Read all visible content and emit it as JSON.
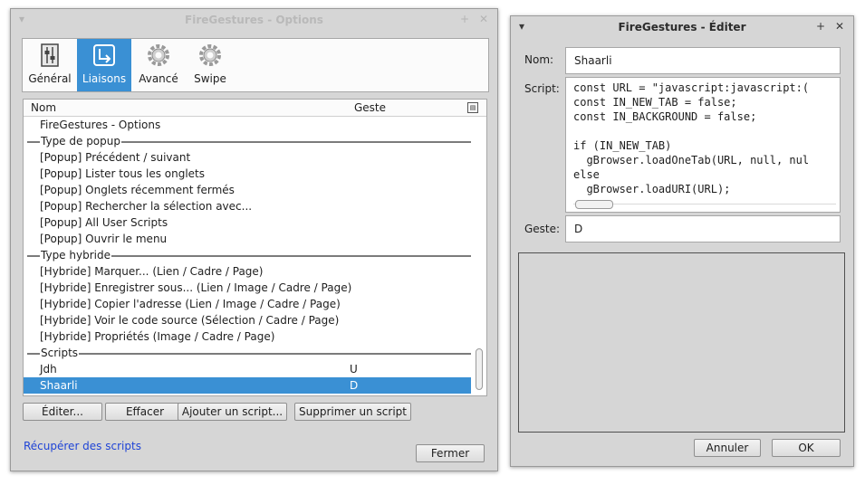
{
  "options": {
    "title": "FireGestures - Options",
    "menu_glyph": "▾",
    "min_glyph": "+",
    "close_glyph": "✕",
    "tabs": [
      {
        "label": "Général",
        "icon": "general-settings-icon"
      },
      {
        "label": "Liaisons",
        "icon": "bindings-icon"
      },
      {
        "label": "Avancé",
        "icon": "gear-icon"
      },
      {
        "label": "Swipe",
        "icon": "gear-icon"
      }
    ],
    "columns": {
      "name": "Nom",
      "gesture": "Geste"
    },
    "rows": [
      {
        "name": "FireGestures - Options",
        "gesture": ""
      },
      {
        "name": "Type de popup",
        "gesture": "",
        "group": true
      },
      {
        "name": "[Popup] Précédent / suivant",
        "gesture": ""
      },
      {
        "name": "[Popup] Lister tous les onglets",
        "gesture": ""
      },
      {
        "name": "[Popup] Onglets récemment fermés",
        "gesture": ""
      },
      {
        "name": "[Popup] Rechercher la sélection avec...",
        "gesture": ""
      },
      {
        "name": "[Popup] All User Scripts",
        "gesture": ""
      },
      {
        "name": "[Popup] Ouvrir le menu",
        "gesture": ""
      },
      {
        "name": "Type hybride",
        "gesture": "",
        "group": true
      },
      {
        "name": "[Hybride] Marquer... (Lien / Cadre / Page)",
        "gesture": ""
      },
      {
        "name": "[Hybride] Enregistrer sous... (Lien / Image / Cadre / Page)",
        "gesture": ""
      },
      {
        "name": "[Hybride] Copier l'adresse (Lien / Image / Cadre / Page)",
        "gesture": ""
      },
      {
        "name": "[Hybride] Voir le code source (Sélection / Cadre / Page)",
        "gesture": ""
      },
      {
        "name": "[Hybride] Propriétés (Image / Cadre / Page)",
        "gesture": ""
      },
      {
        "name": "Scripts",
        "gesture": "",
        "group": true
      },
      {
        "name": "Jdh",
        "gesture": "U"
      },
      {
        "name": "Shaarli",
        "gesture": "D",
        "selected": true
      }
    ],
    "buttons": {
      "edit": "Éditer...",
      "delete": "Effacer",
      "add": "Ajouter un script...",
      "remove": "Supprimer un script"
    },
    "link": "Récupérer des scripts",
    "close": "Fermer",
    "selected_color": "#3a90d4"
  },
  "editor": {
    "title": "FireGestures - Éditer",
    "name_label": "Nom:",
    "name_value": "Shaarli",
    "script_label": "Script:",
    "script_lines": [
      "const URL = \"javascript:javascript:(",
      "const IN_NEW_TAB = false;",
      "const IN_BACKGROUND = false;",
      "",
      "if (IN_NEW_TAB)",
      "  gBrowser.loadOneTab(URL, null, nul",
      "else",
      "  gBrowser.loadURI(URL);"
    ],
    "gesture_label": "Geste:",
    "gesture_value": "D",
    "cancel": "Annuler",
    "ok": "OK"
  }
}
